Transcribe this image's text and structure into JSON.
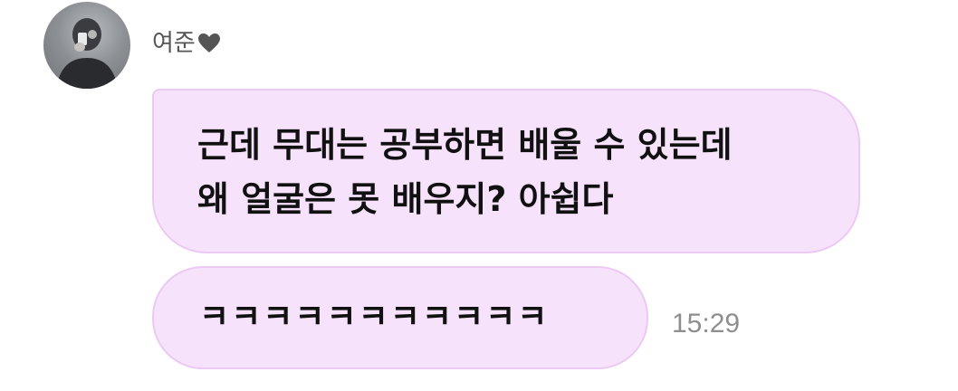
{
  "sender": {
    "name": "여준",
    "heart_icon": "heart-icon",
    "avatar_icon": "avatar"
  },
  "messages": [
    {
      "lines": [
        "근데 무대는 공부하면 배울 수 있는데",
        "왜 얼굴은 못 배우지? 아쉽다"
      ]
    },
    {
      "lines": [
        "ㅋㅋㅋㅋㅋㅋㅋㅋㅋㅋㅋ"
      ],
      "time": "15:29"
    }
  ],
  "colors": {
    "bubble_fill": "#f7e2fb",
    "bubble_border": "#ecc9f3",
    "heart": "#555555",
    "timestamp": "#8e8e8e"
  }
}
